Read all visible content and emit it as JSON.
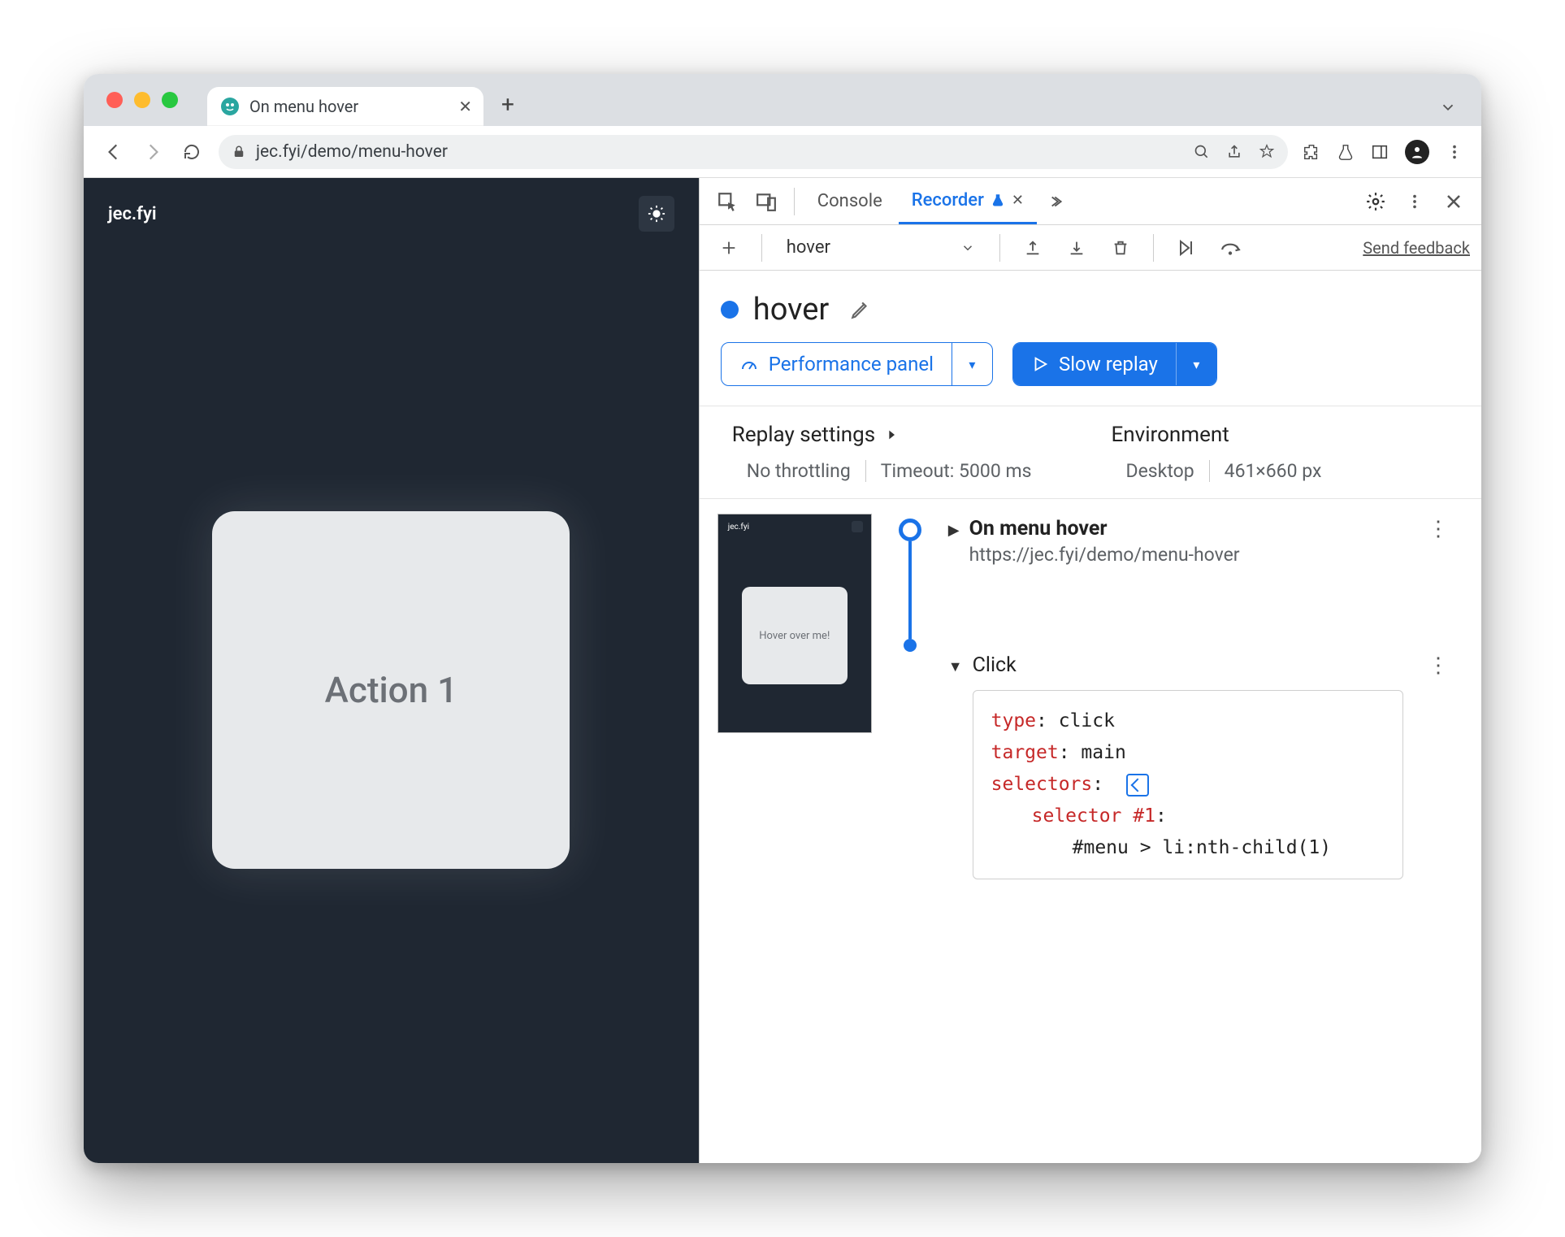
{
  "window": {
    "tab_title": "On menu hover",
    "url_display": "jec.fyi/demo/menu-hover"
  },
  "page": {
    "site_name": "jec.fyi",
    "card_label": "Action 1"
  },
  "devtools": {
    "tabs": {
      "console": "Console",
      "recorder": "Recorder"
    },
    "recorder_toolbar": {
      "recording_name": "hover",
      "feedback": "Send feedback"
    },
    "recording": {
      "title": "hover",
      "perf_button": "Performance panel",
      "replay_button": "Slow replay",
      "settings_header": "Replay settings",
      "throttling": "No throttling",
      "timeout": "Timeout: 5000 ms",
      "env_header": "Environment",
      "env_device": "Desktop",
      "env_dims": "461×660 px"
    },
    "thumb": {
      "site": "jec.fyi",
      "card": "Hover over me!"
    },
    "steps": {
      "s1_title": "On menu hover",
      "s1_url": "https://jec.fyi/demo/menu-hover",
      "s2_title": "Click",
      "code": {
        "k_type": "type",
        "v_type": "click",
        "k_target": "target",
        "v_target": "main",
        "k_selectors": "selectors",
        "k_sel1": "selector #1",
        "sel1_val": "#menu > li:nth-child(1)"
      }
    }
  }
}
